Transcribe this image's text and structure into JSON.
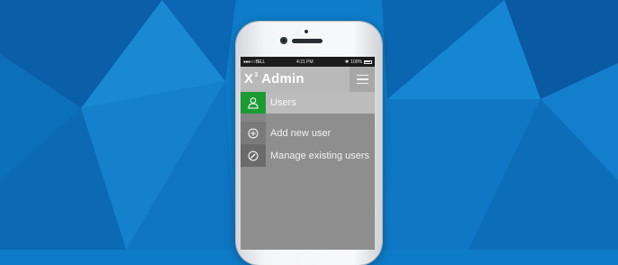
{
  "status_bar": {
    "carrier": "●●●○○ BELL",
    "time": "4:21 PM",
    "bluetooth": "✱",
    "battery": "100%"
  },
  "app": {
    "title": "X",
    "title_sup": "3",
    "title_suffix": " Admin"
  },
  "menu": {
    "items": [
      {
        "label": "Users",
        "icon": "user-icon",
        "active": true
      },
      {
        "label": "Add new user",
        "icon": "plus-circle-icon"
      },
      {
        "label": "Manage existing users",
        "icon": "pencil-circle-icon"
      }
    ]
  },
  "colors": {
    "background": "#0d7bc8",
    "active_green": "#1c9b34",
    "title_bar": "#b9b9b9",
    "menu_panel": "#8e8e8e"
  }
}
